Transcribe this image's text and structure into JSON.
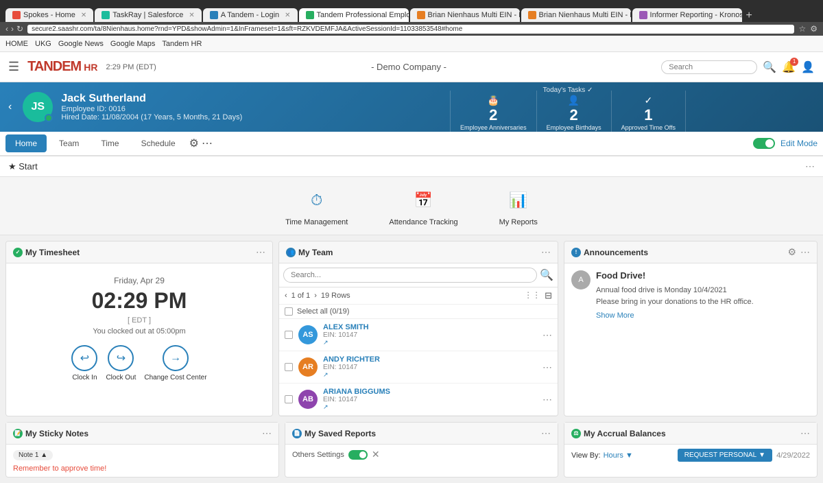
{
  "browser": {
    "tabs": [
      {
        "label": "Spokes - Home",
        "active": false,
        "favicon_color": "#e74c3c"
      },
      {
        "label": "TaskRay | Salesforce",
        "active": false,
        "favicon_color": "#1abc9c"
      },
      {
        "label": "A Tandem - Login",
        "active": false,
        "favicon_color": "#2980b9"
      },
      {
        "label": "Tandem Professional Employe...",
        "active": true,
        "favicon_color": "#27ae60"
      },
      {
        "label": "Brian Nienhaus Multi EIN - Das...",
        "active": false,
        "favicon_color": "#e67e22"
      },
      {
        "label": "Brian Nienhaus Multi EIN - My ...",
        "active": false,
        "favicon_color": "#e67e22"
      },
      {
        "label": "Informer Reporting - Kronos_Jr...",
        "active": false,
        "favicon_color": "#9b59b6"
      }
    ],
    "url": "secure2.saashr.com/ta/8Nienhaus.home?rnd=YPD&showAdmin=1&InFrameset=1&sft=RZKVDEMFJA&ActiveSessionId=11033853548#home"
  },
  "bookmarks": [
    "HOME",
    "UKG",
    "Google News",
    "Google Maps",
    "Tandem HR"
  ],
  "header": {
    "logo": "TANDEM",
    "logo_suffix": "HR",
    "time": "2:29 PM (EDT)",
    "company": "- Demo Company -",
    "search_placeholder": "Search",
    "hamburger": "☰"
  },
  "employee": {
    "initials": "JS",
    "name": "Jack Sutherland",
    "employee_id": "Employee ID: 0016",
    "hired_date": "Hired Date: 11/08/2004 (17 Years, 5 Months, 21 Days)"
  },
  "tasks": {
    "header": "Today's Tasks ✓",
    "items": [
      {
        "count": "2",
        "label": "Employee Anniversaries",
        "icon": "🎂"
      },
      {
        "count": "2",
        "label": "Employee Birthdays",
        "icon": "👤"
      },
      {
        "count": "1",
        "label": "Approved Time Offs",
        "icon": "✓"
      }
    ]
  },
  "nav": {
    "items": [
      "Home",
      "Team",
      "Time",
      "Schedule"
    ],
    "active": "Home",
    "edit_mode": "Edit Mode"
  },
  "star_bar": {
    "label": "★ Start"
  },
  "quick_links": [
    {
      "label": "Time Management",
      "icon": "⏱"
    },
    {
      "label": "Attendance Tracking",
      "icon": "📅"
    },
    {
      "label": "My Reports",
      "icon": "📊"
    }
  ],
  "timesheet_panel": {
    "title": "My Timesheet",
    "date": "Friday, Apr 29",
    "time": "02:29 PM",
    "timezone": "[ EDT ]",
    "clocked_out": "You clocked out at 05:00pm",
    "actions": [
      {
        "label": "Clock In",
        "icon": "↩"
      },
      {
        "label": "Clock Out",
        "icon": "↪"
      },
      {
        "label": "Change Cost Center",
        "icon": "→"
      }
    ]
  },
  "team_panel": {
    "title": "My Team",
    "search_placeholder": "Search...",
    "pagination": "1 of 1",
    "rows": "19 Rows",
    "select_all": "Select all (0/19)",
    "members": [
      {
        "initials": "AS",
        "name": "ALEX SMITH",
        "ein": "EIN: 10147",
        "color": "#3498db"
      },
      {
        "initials": "AR",
        "name": "ANDY RICHTER",
        "ein": "EIN: 10147",
        "color": "#e67e22"
      },
      {
        "initials": "AB",
        "name": "ARIANA BIGGUMS",
        "ein": "EIN: 10147",
        "color": "#8e44ad"
      }
    ]
  },
  "announcements_panel": {
    "title": "Announcements",
    "announcement_title": "Food Drive!",
    "announcement_text": "Annual food drive is Monday 10/4/2021\nPlease bring in your donations to the HR office.",
    "show_more": "Show More",
    "avatar_initials": "A"
  },
  "sticky_notes_panel": {
    "title": "My Sticky Notes",
    "note_tag": "Note 1 ▲",
    "note_text": "Remember to approve time!"
  },
  "saved_reports_panel": {
    "title": "My Saved Reports",
    "settings": "Others Settings",
    "toggle": true
  },
  "accrual_panel": {
    "title": "My Accrual Balances",
    "view_by": "View By:",
    "hours_label": "Hours ▼",
    "request_btn": "REQUEST PERSONAL",
    "request_icon": "▼",
    "date": "4/29/2022"
  }
}
